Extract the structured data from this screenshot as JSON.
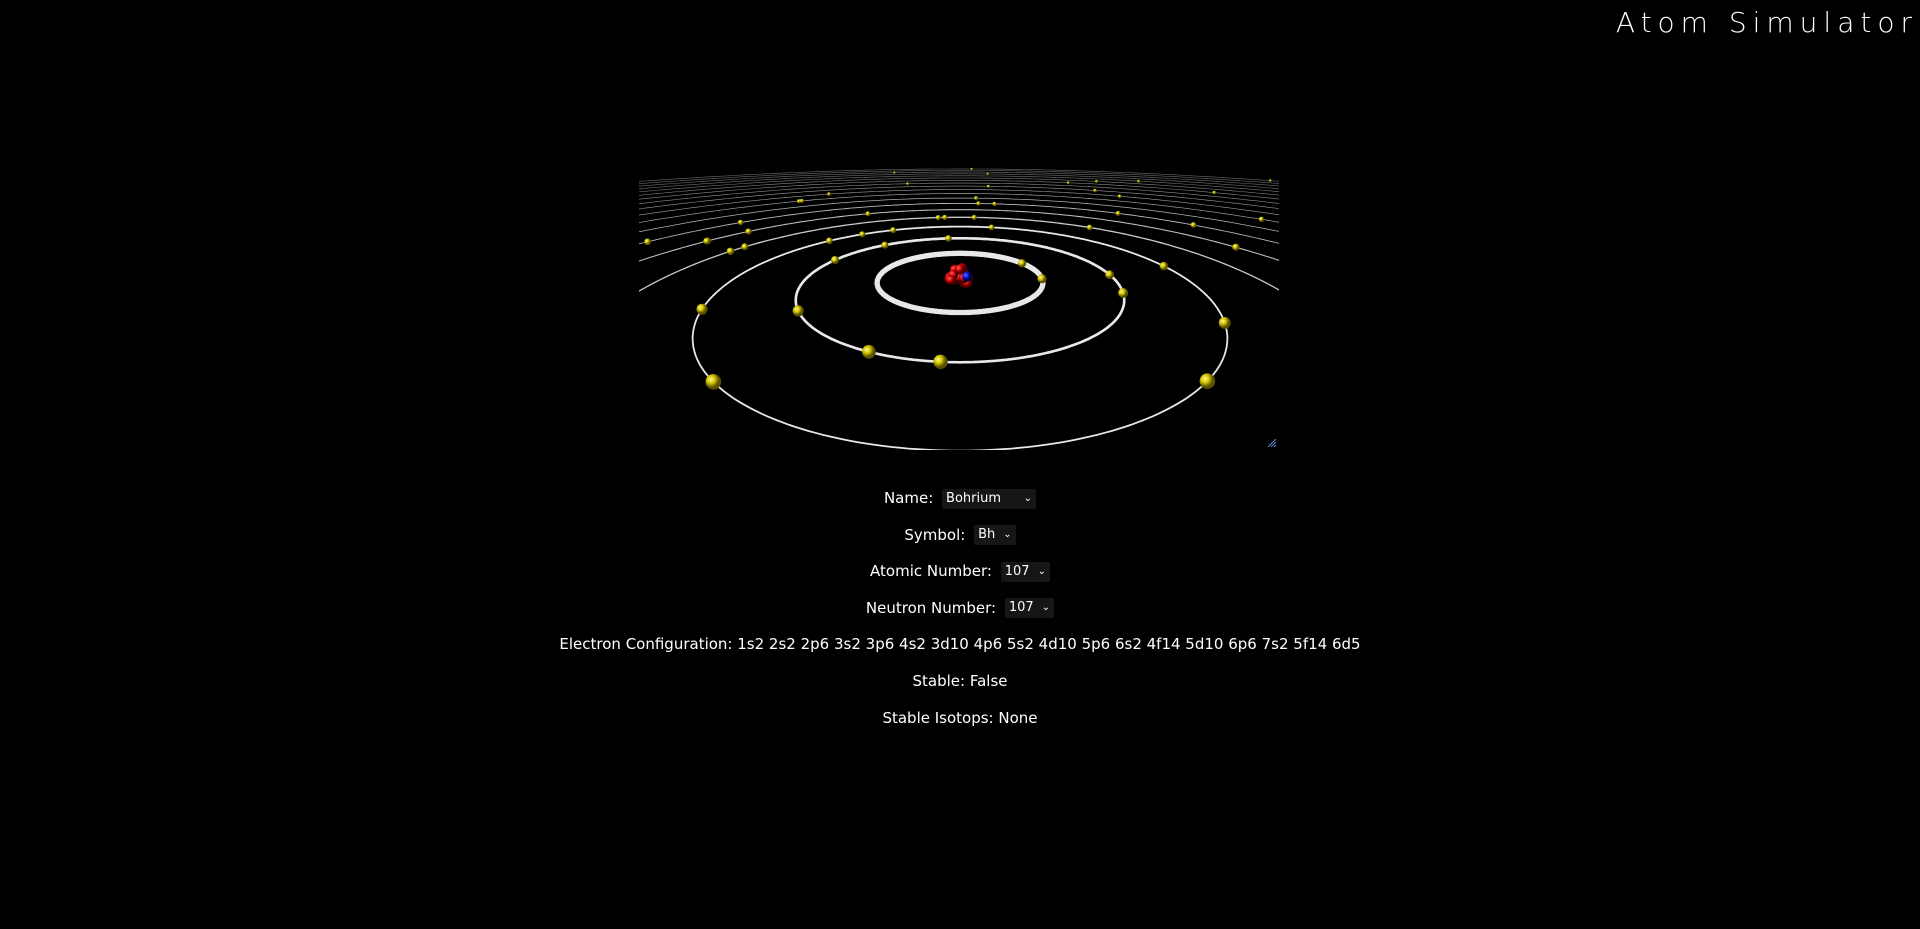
{
  "header": {
    "title": "Atom Simulator"
  },
  "viewer": {
    "orbit_color": "#e8e8e8",
    "electron_color": "#d4c800",
    "proton_color": "#cc0000",
    "neutron_color": "#0010cc"
  },
  "form": {
    "name": {
      "label": "Name:",
      "value": "Bohrium"
    },
    "symbol": {
      "label": "Symbol:",
      "value": "Bh"
    },
    "atomic_number": {
      "label": "Atomic Number:",
      "value": "107"
    },
    "neutron_number": {
      "label": "Neutron Number:",
      "value": "107"
    },
    "electron_configuration": {
      "label": "Electron Configuration:",
      "value": "1s2 2s2 2p6 3s2 3p6 4s2 3d10 4p6 5s2 4d10 5p6 6s2 4f14 5d10 6p6 7s2 5f14 6d5"
    },
    "stable": {
      "label": "Stable:",
      "value": "False"
    },
    "stable_isotopes": {
      "label": "Stable Isotops:",
      "value": "None"
    }
  }
}
